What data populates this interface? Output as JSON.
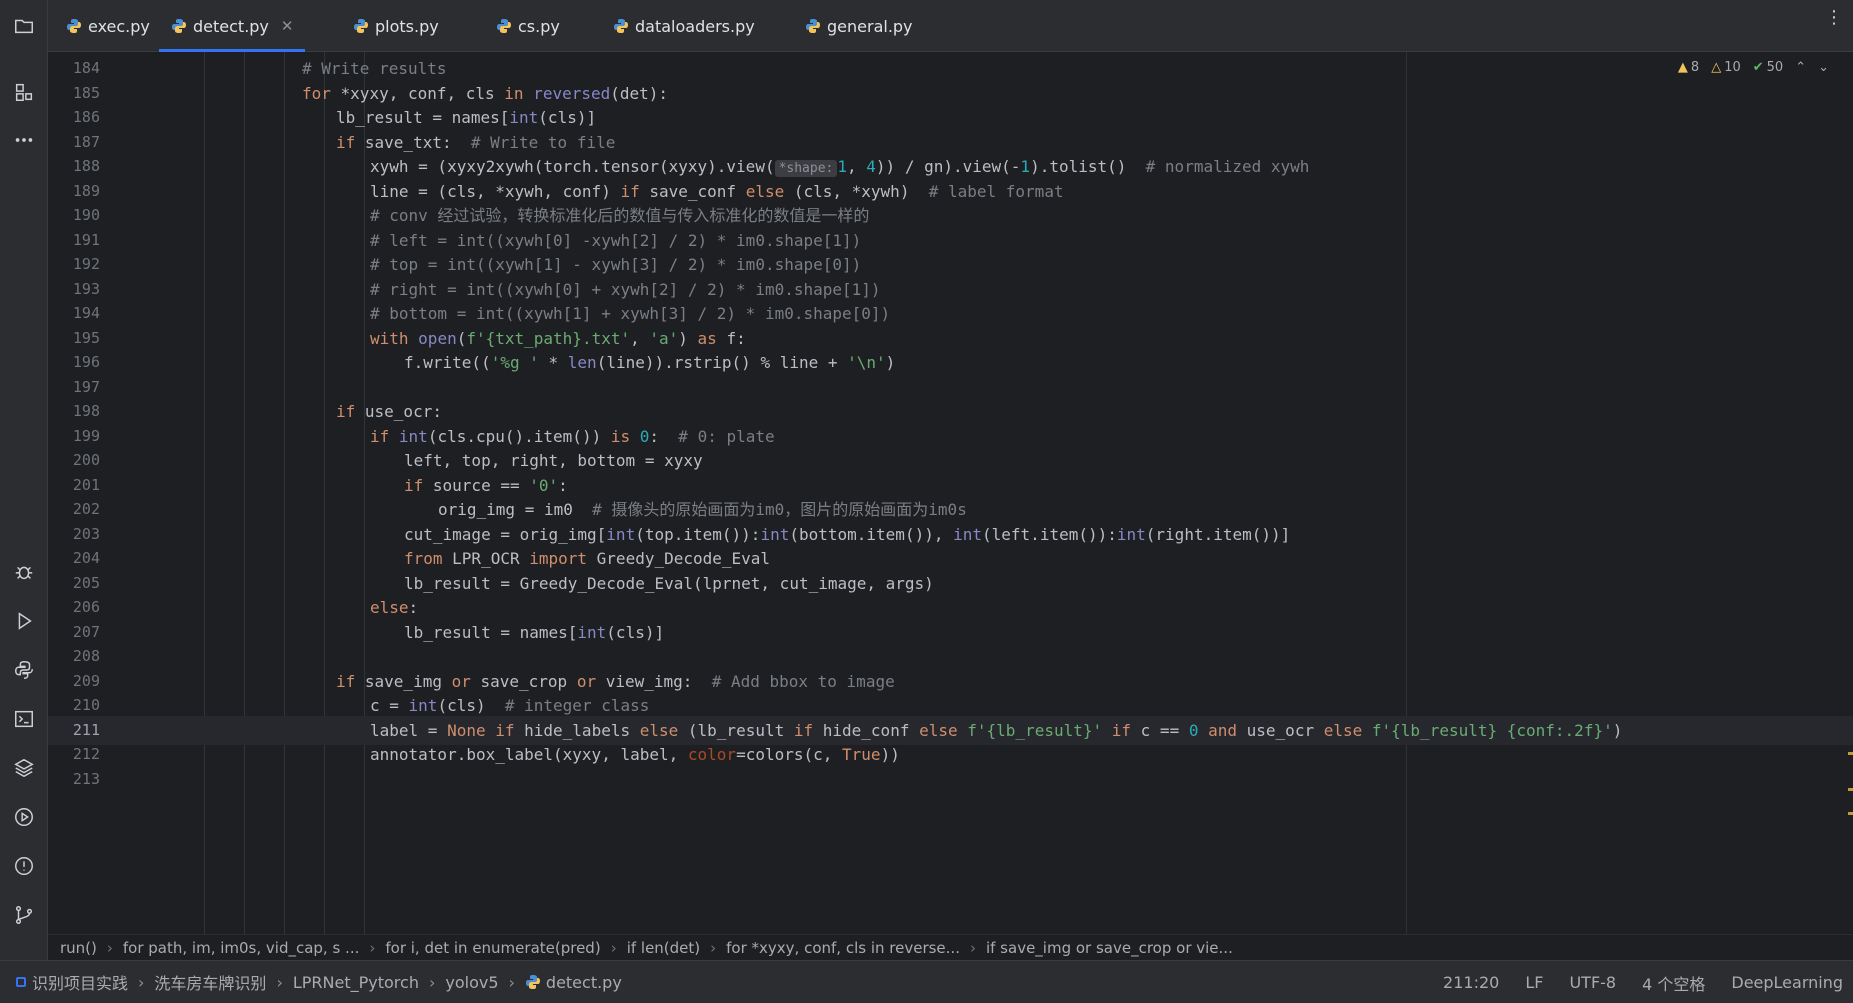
{
  "tabs": [
    {
      "label": "exec.py",
      "active": false
    },
    {
      "label": "detect.py",
      "active": true
    },
    {
      "label": "plots.py",
      "active": false
    },
    {
      "label": "cs.py",
      "active": false
    },
    {
      "label": "dataloaders.py",
      "active": false
    },
    {
      "label": "general.py",
      "active": false
    }
  ],
  "inspections": {
    "warnings_a": "8",
    "warnings_b": "10",
    "ok": "50"
  },
  "code_lines": [
    {
      "n": "184",
      "text": "# Write results"
    },
    {
      "n": "185",
      "text": "for *xyxy, conf, cls in reversed(det):"
    },
    {
      "n": "186",
      "text": "lb_result = names[int(cls)]"
    },
    {
      "n": "187",
      "text": "if save_txt:  # Write to file"
    },
    {
      "n": "188",
      "text": "xywh = (xyxy2xywh(torch.tensor(xyxy).view(*shape: 1, 4)) / gn).view(-1).tolist()  # normalized xywh"
    },
    {
      "n": "189",
      "text": "line = (cls, *xywh, conf) if save_conf else (cls, *xywh)  # label format"
    },
    {
      "n": "190",
      "text": "# conv 经过试验，转换标准化后的数值与传入标准化的数值是一样的"
    },
    {
      "n": "191",
      "text": "# left = int((xywh[0] -xywh[2] / 2) * im0.shape[1])"
    },
    {
      "n": "192",
      "text": "# top = int((xywh[1] - xywh[3] / 2) * im0.shape[0])"
    },
    {
      "n": "193",
      "text": "# right = int((xywh[0] + xywh[2] / 2) * im0.shape[1])"
    },
    {
      "n": "194",
      "text": "# bottom = int((xywh[1] + xywh[3] / 2) * im0.shape[0])"
    },
    {
      "n": "195",
      "text": "with open(f'{txt_path}.txt', 'a') as f:"
    },
    {
      "n": "196",
      "text": "f.write(('%g ' * len(line)).rstrip() % line + '\\n')"
    },
    {
      "n": "197",
      "text": ""
    },
    {
      "n": "198",
      "text": "if use_ocr:"
    },
    {
      "n": "199",
      "text": "if int(cls.cpu().item()) is 0:  # 0: plate"
    },
    {
      "n": "200",
      "text": "left, top, right, bottom = xyxy"
    },
    {
      "n": "201",
      "text": "if source == '0':"
    },
    {
      "n": "202",
      "text": "orig_img = im0  # 摄像头的原始画面为im0，图片的原始画面为im0s"
    },
    {
      "n": "203",
      "text": "cut_image = orig_img[int(top.item()):int(bottom.item()), int(left.item()):int(right.item())]"
    },
    {
      "n": "204",
      "text": "from LPR_OCR import Greedy_Decode_Eval"
    },
    {
      "n": "205",
      "text": "lb_result = Greedy_Decode_Eval(lprnet, cut_image, args)"
    },
    {
      "n": "206",
      "text": "else:"
    },
    {
      "n": "207",
      "text": "lb_result = names[int(cls)]"
    },
    {
      "n": "208",
      "text": ""
    },
    {
      "n": "209",
      "text": "if save_img or save_crop or view_img:  # Add bbox to image"
    },
    {
      "n": "210",
      "text": "c = int(cls)  # integer class"
    },
    {
      "n": "211",
      "text": "label = None if hide_labels else (lb_result if hide_conf else f'{lb_result}' if c == 0 and use_ocr else f'{lb_result} {conf:.2f}')"
    },
    {
      "n": "212",
      "text": "annotator.box_label(xyxy, label, color=colors(c, True))"
    },
    {
      "n": "213",
      "text": ""
    }
  ],
  "breadcrumbs": [
    "run()",
    "for path, im, im0s, vid_cap, s ...",
    "for i, det in enumerate(pred)",
    "if len(det)",
    "for *xyxy, conf, cls in reverse...",
    "if save_img or save_crop or vie..."
  ],
  "status": {
    "path": [
      "识别项目实践",
      "洗车房车牌识别",
      "LPRNet_Pytorch",
      "yolov5",
      "detect.py"
    ],
    "position": "211:20",
    "line_sep": "LF",
    "encoding": "UTF-8",
    "indent": "4 个空格",
    "interpreter": "DeepLearning"
  },
  "colors": {
    "accent": "#3574f0",
    "background": "#1e1f22",
    "panel": "#2b2d30"
  },
  "icons": [
    "folder-icon",
    "structure-icon",
    "more-icon",
    "debug-icon",
    "run-icon",
    "python-console-icon",
    "terminal-icon",
    "layers-icon",
    "services-icon",
    "problems-icon",
    "git-icon"
  ]
}
